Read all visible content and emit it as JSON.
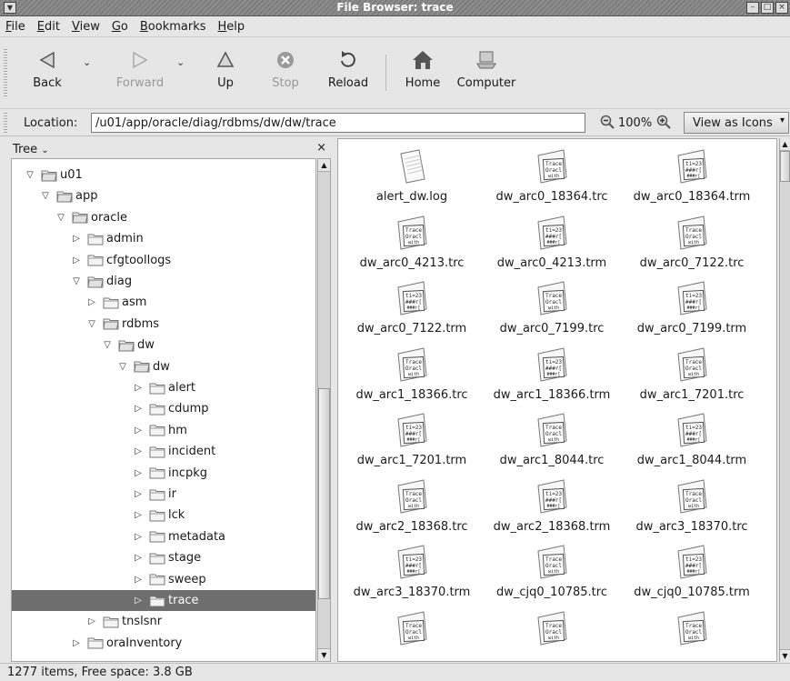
{
  "window": {
    "title": "File Browser: trace",
    "buttons": [
      "minimize",
      "maximize",
      "close"
    ]
  },
  "menubar": [
    {
      "label": "File",
      "mnemonic": "F",
      "rest": "ile"
    },
    {
      "label": "Edit",
      "mnemonic": "E",
      "rest": "dit"
    },
    {
      "label": "View",
      "mnemonic": "V",
      "rest": "iew"
    },
    {
      "label": "Go",
      "mnemonic": "G",
      "rest": "o"
    },
    {
      "label": "Bookmarks",
      "mnemonic": "B",
      "rest": "ookmarks"
    },
    {
      "label": "Help",
      "mnemonic": "H",
      "rest": "elp"
    }
  ],
  "toolbar": {
    "back": "Back",
    "forward": "Forward",
    "up": "Up",
    "stop": "Stop",
    "reload": "Reload",
    "home": "Home",
    "computer": "Computer"
  },
  "location": {
    "label": "Location:",
    "path": "/u01/app/oracle/diag/rdbms/dw/dw/trace",
    "zoom": "100%",
    "view_as": "View as Icons"
  },
  "sidebar": {
    "title": "Tree",
    "close": "×",
    "nodes": [
      {
        "label": "u01",
        "depth": 0,
        "expanded": true
      },
      {
        "label": "app",
        "depth": 1,
        "expanded": true
      },
      {
        "label": "oracle",
        "depth": 2,
        "expanded": true
      },
      {
        "label": "admin",
        "depth": 3,
        "expanded": false
      },
      {
        "label": "cfgtoollogs",
        "depth": 3,
        "expanded": false
      },
      {
        "label": "diag",
        "depth": 3,
        "expanded": true
      },
      {
        "label": "asm",
        "depth": 4,
        "expanded": false
      },
      {
        "label": "rdbms",
        "depth": 4,
        "expanded": true
      },
      {
        "label": "dw",
        "depth": 5,
        "expanded": true
      },
      {
        "label": "dw",
        "depth": 6,
        "expanded": true
      },
      {
        "label": "alert",
        "depth": 7,
        "expanded": false
      },
      {
        "label": "cdump",
        "depth": 7,
        "expanded": false
      },
      {
        "label": "hm",
        "depth": 7,
        "expanded": false
      },
      {
        "label": "incident",
        "depth": 7,
        "expanded": false
      },
      {
        "label": "incpkg",
        "depth": 7,
        "expanded": false
      },
      {
        "label": "ir",
        "depth": 7,
        "expanded": false
      },
      {
        "label": "lck",
        "depth": 7,
        "expanded": false
      },
      {
        "label": "metadata",
        "depth": 7,
        "expanded": false
      },
      {
        "label": "stage",
        "depth": 7,
        "expanded": false
      },
      {
        "label": "sweep",
        "depth": 7,
        "expanded": false
      },
      {
        "label": "trace",
        "depth": 7,
        "expanded": false,
        "selected": true
      },
      {
        "label": "tnslsnr",
        "depth": 4,
        "expanded": false
      },
      {
        "label": "oraInventory",
        "depth": 3,
        "expanded": false
      }
    ]
  },
  "files": [
    {
      "name": "alert_dw.log",
      "icon": "text-file-icon"
    },
    {
      "name": "dw_arc0_18364.trc",
      "icon": "trace-file-icon"
    },
    {
      "name": "dw_arc0_18364.trm",
      "icon": "trm-file-icon"
    },
    {
      "name": "dw_arc0_4213.trc",
      "icon": "trace-file-icon"
    },
    {
      "name": "dw_arc0_4213.trm",
      "icon": "trm-file-icon"
    },
    {
      "name": "dw_arc0_7122.trc",
      "icon": "trace-file-icon"
    },
    {
      "name": "dw_arc0_7122.trm",
      "icon": "trm-file-icon"
    },
    {
      "name": "dw_arc0_7199.trc",
      "icon": "trace-file-icon"
    },
    {
      "name": "dw_arc0_7199.trm",
      "icon": "trm-file-icon"
    },
    {
      "name": "dw_arc1_18366.trc",
      "icon": "trace-file-icon"
    },
    {
      "name": "dw_arc1_18366.trm",
      "icon": "trm-file-icon"
    },
    {
      "name": "dw_arc1_7201.trc",
      "icon": "trace-file-icon"
    },
    {
      "name": "dw_arc1_7201.trm",
      "icon": "trm-file-icon"
    },
    {
      "name": "dw_arc1_8044.trc",
      "icon": "trace-file-icon"
    },
    {
      "name": "dw_arc1_8044.trm",
      "icon": "trm-file-icon"
    },
    {
      "name": "dw_arc2_18368.trc",
      "icon": "trace-file-icon"
    },
    {
      "name": "dw_arc2_18368.trm",
      "icon": "trm-file-icon"
    },
    {
      "name": "dw_arc3_18370.trc",
      "icon": "trace-file-icon"
    },
    {
      "name": "dw_arc3_18370.trm",
      "icon": "trm-file-icon"
    },
    {
      "name": "dw_cjq0_10785.trc",
      "icon": "trace-file-icon"
    },
    {
      "name": "dw_cjq0_10785.trm",
      "icon": "trm-file-icon"
    }
  ],
  "status": "1277 items, Free space: 3.8 GB",
  "icon_text": {
    "trc": [
      "Trace",
      "Oracl",
      "with"
    ],
    "trm": [
      "ti=23",
      "###r[",
      "###r["
    ]
  },
  "colors": {
    "selection": "#6e6e6e",
    "titlebar": "#858585"
  }
}
